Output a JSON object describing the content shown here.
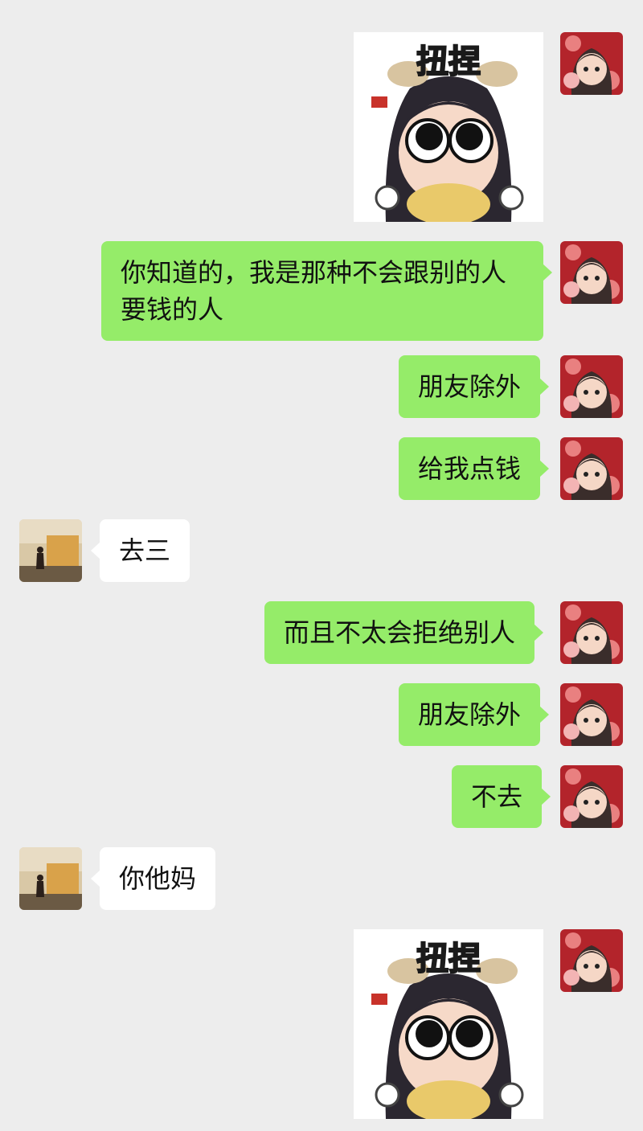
{
  "chat": {
    "messages": [
      {
        "sender": "me",
        "kind": "sticker",
        "caption": "扭捏"
      },
      {
        "sender": "me",
        "kind": "text",
        "text": "你知道的，我是那种不会跟别的人要钱的人"
      },
      {
        "sender": "me",
        "kind": "text",
        "text": "朋友除外"
      },
      {
        "sender": "me",
        "kind": "text",
        "text": "给我点钱"
      },
      {
        "sender": "other",
        "kind": "text",
        "text": "去三"
      },
      {
        "sender": "me",
        "kind": "text",
        "text": "而且不太会拒绝别人"
      },
      {
        "sender": "me",
        "kind": "text",
        "text": "朋友除外"
      },
      {
        "sender": "me",
        "kind": "text",
        "text": "不去"
      },
      {
        "sender": "other",
        "kind": "text",
        "text": "你他妈"
      },
      {
        "sender": "me",
        "kind": "sticker",
        "caption": "扭捏"
      }
    ]
  },
  "colors": {
    "background": "#ededed",
    "my_bubble": "#95ec69",
    "other_bubble": "#ffffff"
  },
  "icons": {
    "my_avatar": "anime-girl-avatar",
    "other_avatar": "photo-person-avatar"
  }
}
